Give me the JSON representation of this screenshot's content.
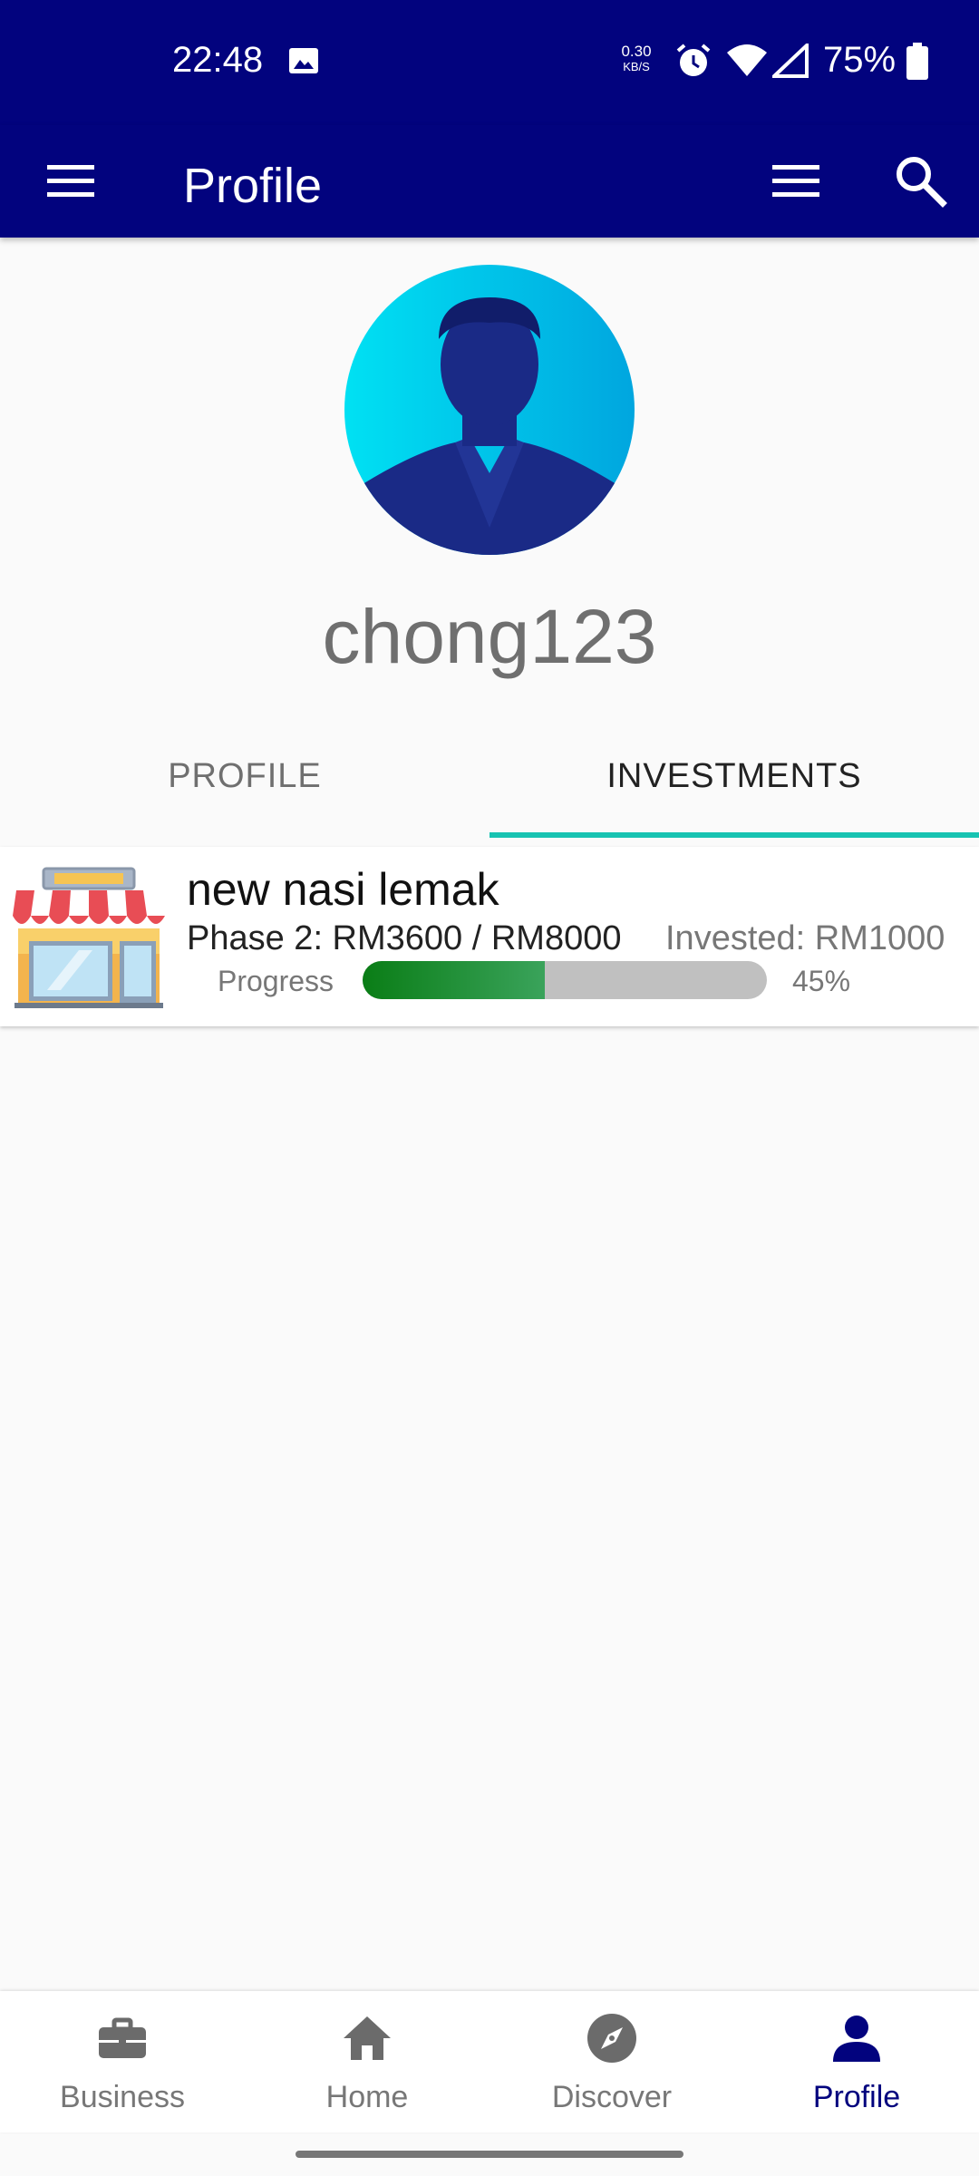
{
  "status_bar": {
    "time": "22:48",
    "net_speed_value": "0.30",
    "net_speed_unit": "KB/S",
    "battery_percent": "75%",
    "icons": [
      "image-icon",
      "alarm-icon",
      "wifi-icon",
      "signal-icon",
      "battery-icon"
    ]
  },
  "app_bar": {
    "title": "Profile",
    "background_color": "#02037e"
  },
  "profile": {
    "username": "chong123"
  },
  "tabs": [
    {
      "label": "PROFILE",
      "selected": false
    },
    {
      "label": "INVESTMENTS",
      "selected": true
    }
  ],
  "tab_indicator_color": "#17c3b2",
  "investments": [
    {
      "name": "new nasi lemak",
      "phase_text": "Phase 2: RM3600 / RM8000",
      "invested_text": "Invested: RM1000",
      "progress_label": "Progress",
      "progress_percent_text": "45%",
      "progress_value": 45
    }
  ],
  "bottom_nav": {
    "items": [
      {
        "label": "Business",
        "icon": "briefcase-icon",
        "active": false
      },
      {
        "label": "Home",
        "icon": "home-icon",
        "active": false
      },
      {
        "label": "Discover",
        "icon": "compass-icon",
        "active": false
      },
      {
        "label": "Profile",
        "icon": "person-icon",
        "active": true
      }
    ],
    "active_color": "#02037e",
    "inactive_color": "#6b6b6b"
  }
}
